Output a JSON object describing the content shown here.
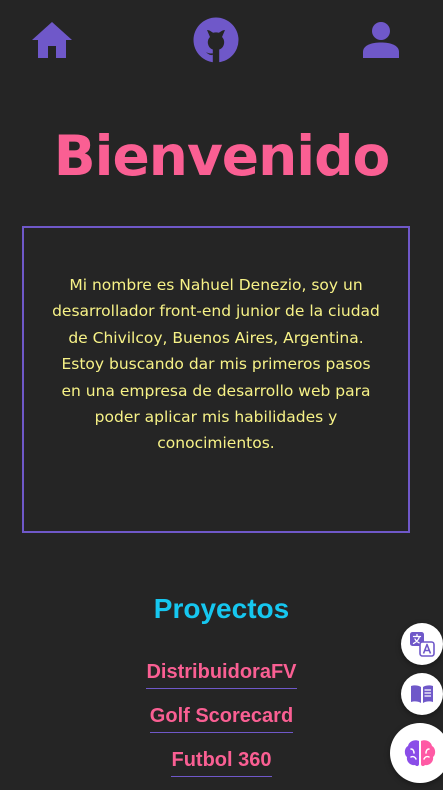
{
  "nav": {
    "items": [
      {
        "icon": "home-icon"
      },
      {
        "icon": "github-icon"
      },
      {
        "icon": "user-icon"
      }
    ],
    "accent_color": "#6f58c9"
  },
  "hero": {
    "title": "Bienvenido",
    "title_color": "#fa5f93"
  },
  "about": {
    "text": "Mi nombre es Nahuel Denezio, soy un desarrollador front-end junior de la ciudad de Chivilcoy, Buenos Aires, Argentina. Estoy buscando dar mis primeros pasos en una empresa de desarrollo web para poder aplicar mis habilidades y conocimientos.",
    "text_color": "#f7f287",
    "border_color": "#6f58c9"
  },
  "projects": {
    "heading": "Proyectos",
    "heading_color": "#16c7f0",
    "items": [
      {
        "label": "DistribuidoraFV"
      },
      {
        "label": "Golf Scorecard"
      },
      {
        "label": "Futbol 360"
      }
    ]
  },
  "floating_buttons": [
    {
      "icon": "translate-icon"
    },
    {
      "icon": "reader-icon"
    },
    {
      "icon": "ai-brain-icon"
    }
  ],
  "background_color": "#252525"
}
